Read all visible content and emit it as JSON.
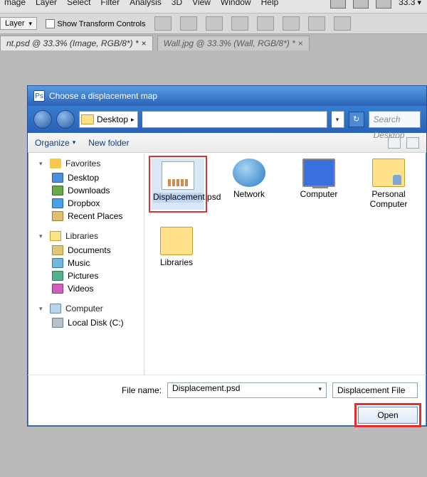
{
  "host": {
    "menu": [
      "mage",
      "Layer",
      "Select",
      "Filter",
      "Analysis",
      "3D",
      "View",
      "Window",
      "Help"
    ],
    "zoom": "33.3",
    "opt_select": "Layer",
    "show_transform": "Show Transform Controls",
    "tabs": [
      "nt.psd @ 33.3% (Image, RGB/8*) *",
      "Wall.jpg @ 33.3% (Wall, RGB/8*) *"
    ]
  },
  "dialog": {
    "title": "Choose a displacement map",
    "crumb": "Desktop",
    "search_placeholder": "Search Desktop",
    "toolbar": {
      "organize": "Organize",
      "newfolder": "New folder"
    },
    "sidebar": {
      "favorites": "Favorites",
      "fav_items": [
        "Desktop",
        "Downloads",
        "Dropbox",
        "Recent Places"
      ],
      "libraries": "Libraries",
      "lib_items": [
        "Documents",
        "Music",
        "Pictures",
        "Videos"
      ],
      "computer": "Computer",
      "comp_items": [
        "Local Disk (C:)"
      ]
    },
    "files": {
      "displacement": "Displacement.psd",
      "network": "Network",
      "computer": "Computer",
      "personal": "Personal Computer",
      "libraries": "Libraries"
    },
    "file_name_label": "File name:",
    "file_name_value": "Displacement.psd",
    "file_type": "Displacement File",
    "open": "Open"
  }
}
